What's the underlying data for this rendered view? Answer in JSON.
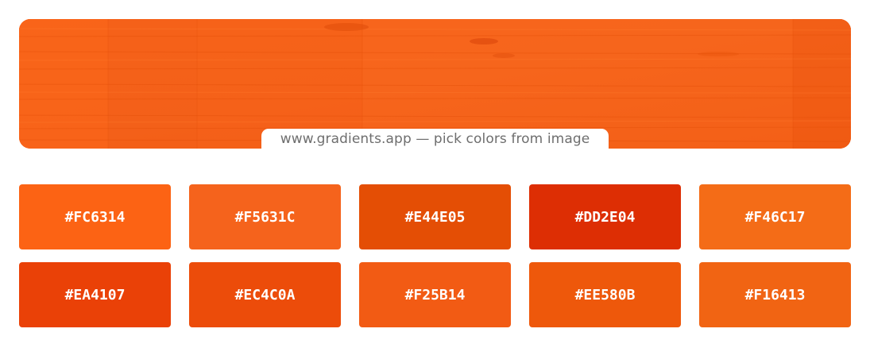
{
  "caption": "www.gradients.app — pick colors from image",
  "hero": {
    "base_color": "#F5631C"
  },
  "swatches": [
    {
      "label": "#FC6314",
      "color": "#FC6314"
    },
    {
      "label": "#F5631C",
      "color": "#F5631C"
    },
    {
      "label": "#E44E05",
      "color": "#E44E05"
    },
    {
      "label": "#DD2E04",
      "color": "#DD2E04"
    },
    {
      "label": "#F46C17",
      "color": "#F46C17"
    },
    {
      "label": "#EA4107",
      "color": "#EA4107"
    },
    {
      "label": "#EC4C0A",
      "color": "#EC4C0A"
    },
    {
      "label": "#F25B14",
      "color": "#F25B14"
    },
    {
      "label": "#EE580B",
      "color": "#EE580B"
    },
    {
      "label": "#F16413",
      "color": "#F16413"
    }
  ]
}
